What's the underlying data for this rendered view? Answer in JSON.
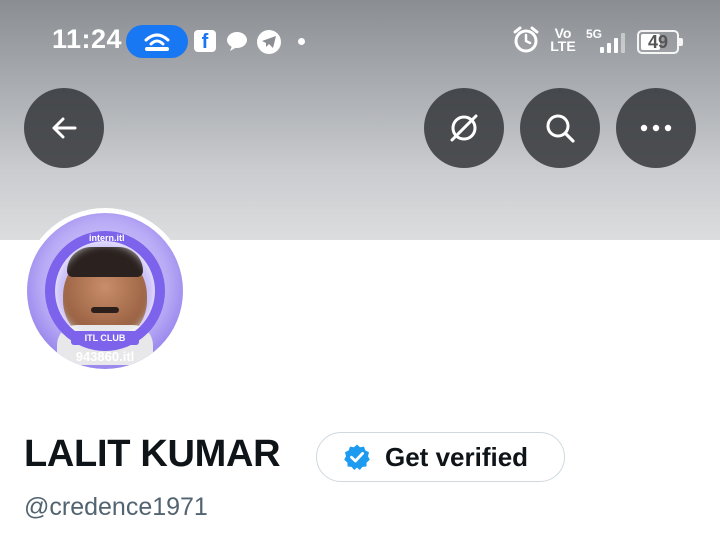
{
  "status_bar": {
    "time": "11:24",
    "network_label": "Vo\nLTE",
    "network_type": "5G",
    "battery_percent": "49",
    "battery_level": 0.49
  },
  "header": {
    "back_icon": "arrow-left-icon",
    "grok_icon": "grok-icon",
    "search_icon": "search-icon",
    "more_icon": "more-icon"
  },
  "avatar": {
    "badge_brand": "intern.itl",
    "club_label": "ITL CLUB",
    "club_id": "943860.itl"
  },
  "profile": {
    "display_name": "LALIT KUMAR",
    "handle": "@credence1971",
    "verify_label": "Get verified"
  },
  "colors": {
    "accent": "#1d9bf0",
    "text_primary": "#0f1419",
    "text_secondary": "#536471",
    "hotspot_pill": "#1877f2"
  }
}
